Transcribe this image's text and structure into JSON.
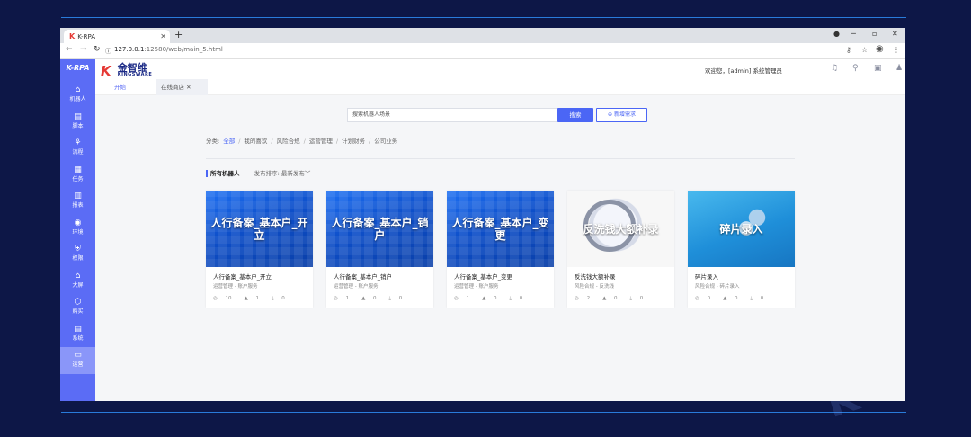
{
  "browser": {
    "tab_title": "K-RPA",
    "tab_logo": "K",
    "url_host": "127.0.0.1",
    "url_path": ":12580/web/main_5.html"
  },
  "sidebar": {
    "logo": "K-RPA",
    "items": [
      {
        "label": "机器人",
        "icon": "robot-icon"
      },
      {
        "label": "脚本",
        "icon": "script-icon"
      },
      {
        "label": "流程",
        "icon": "flow-icon"
      },
      {
        "label": "任务",
        "icon": "task-icon"
      },
      {
        "label": "报表",
        "icon": "report-icon"
      },
      {
        "label": "环境",
        "icon": "environment-icon"
      },
      {
        "label": "权限",
        "icon": "permission-icon"
      },
      {
        "label": "大屏",
        "icon": "screen-icon"
      },
      {
        "label": "购买",
        "icon": "purchase-icon"
      },
      {
        "label": "系统",
        "icon": "system-icon"
      },
      {
        "label": "运营",
        "icon": "operation-icon"
      }
    ]
  },
  "header": {
    "brand_letter": "K",
    "brand_cn": "金智维",
    "brand_en": "KINGSWARE",
    "welcome": "欢迎您，[admin] 系统管理员"
  },
  "page_tabs": [
    {
      "label": "开始"
    },
    {
      "label": "在线商店"
    }
  ],
  "search": {
    "placeholder": "搜索机器人场景",
    "button": "搜索",
    "add_button": "新增需求"
  },
  "categories": {
    "prefix": "分类:",
    "items": [
      "全部",
      "我的喜欢",
      "风险合规",
      "运营管理",
      "计划财务",
      "公司业务"
    ]
  },
  "sort": {
    "all_label": "所有机器人",
    "sort_label": "发布排序:",
    "sort_value": "最新发布"
  },
  "cards": [
    {
      "overlay": "人行备案_基本户_开立",
      "name": "人行备案_基本户_开立",
      "sub": "运营管理 - 账户服务",
      "views": "10",
      "likes": "1",
      "downloads": "0",
      "style": "keyboard"
    },
    {
      "overlay": "人行备案_基本户_销户",
      "name": "人行备案_基本户_销户",
      "sub": "运营管理 - 账户服务",
      "views": "1",
      "likes": "0",
      "downloads": "0",
      "style": "keyboard"
    },
    {
      "overlay": "人行备案_基本户_变更",
      "name": "人行备案_基本户_变更",
      "sub": "运营管理 - 账户服务",
      "views": "1",
      "likes": "0",
      "downloads": "0",
      "style": "keyboard"
    },
    {
      "overlay": "反洗钱大额补录",
      "name": "反洗钱大额补录",
      "sub": "风险合规 - 反洗钱",
      "views": "2",
      "likes": "0",
      "downloads": "0",
      "style": "magnifier"
    },
    {
      "overlay": "碎片录入",
      "name": "碎片录入",
      "sub": "风险合规 - 碎片录入",
      "views": "0",
      "likes": "0",
      "downloads": "0",
      "style": "fragments"
    }
  ],
  "colors": {
    "sidebar": "#5b6cf5",
    "primary": "#4b66f5",
    "background": "#0d1747"
  }
}
